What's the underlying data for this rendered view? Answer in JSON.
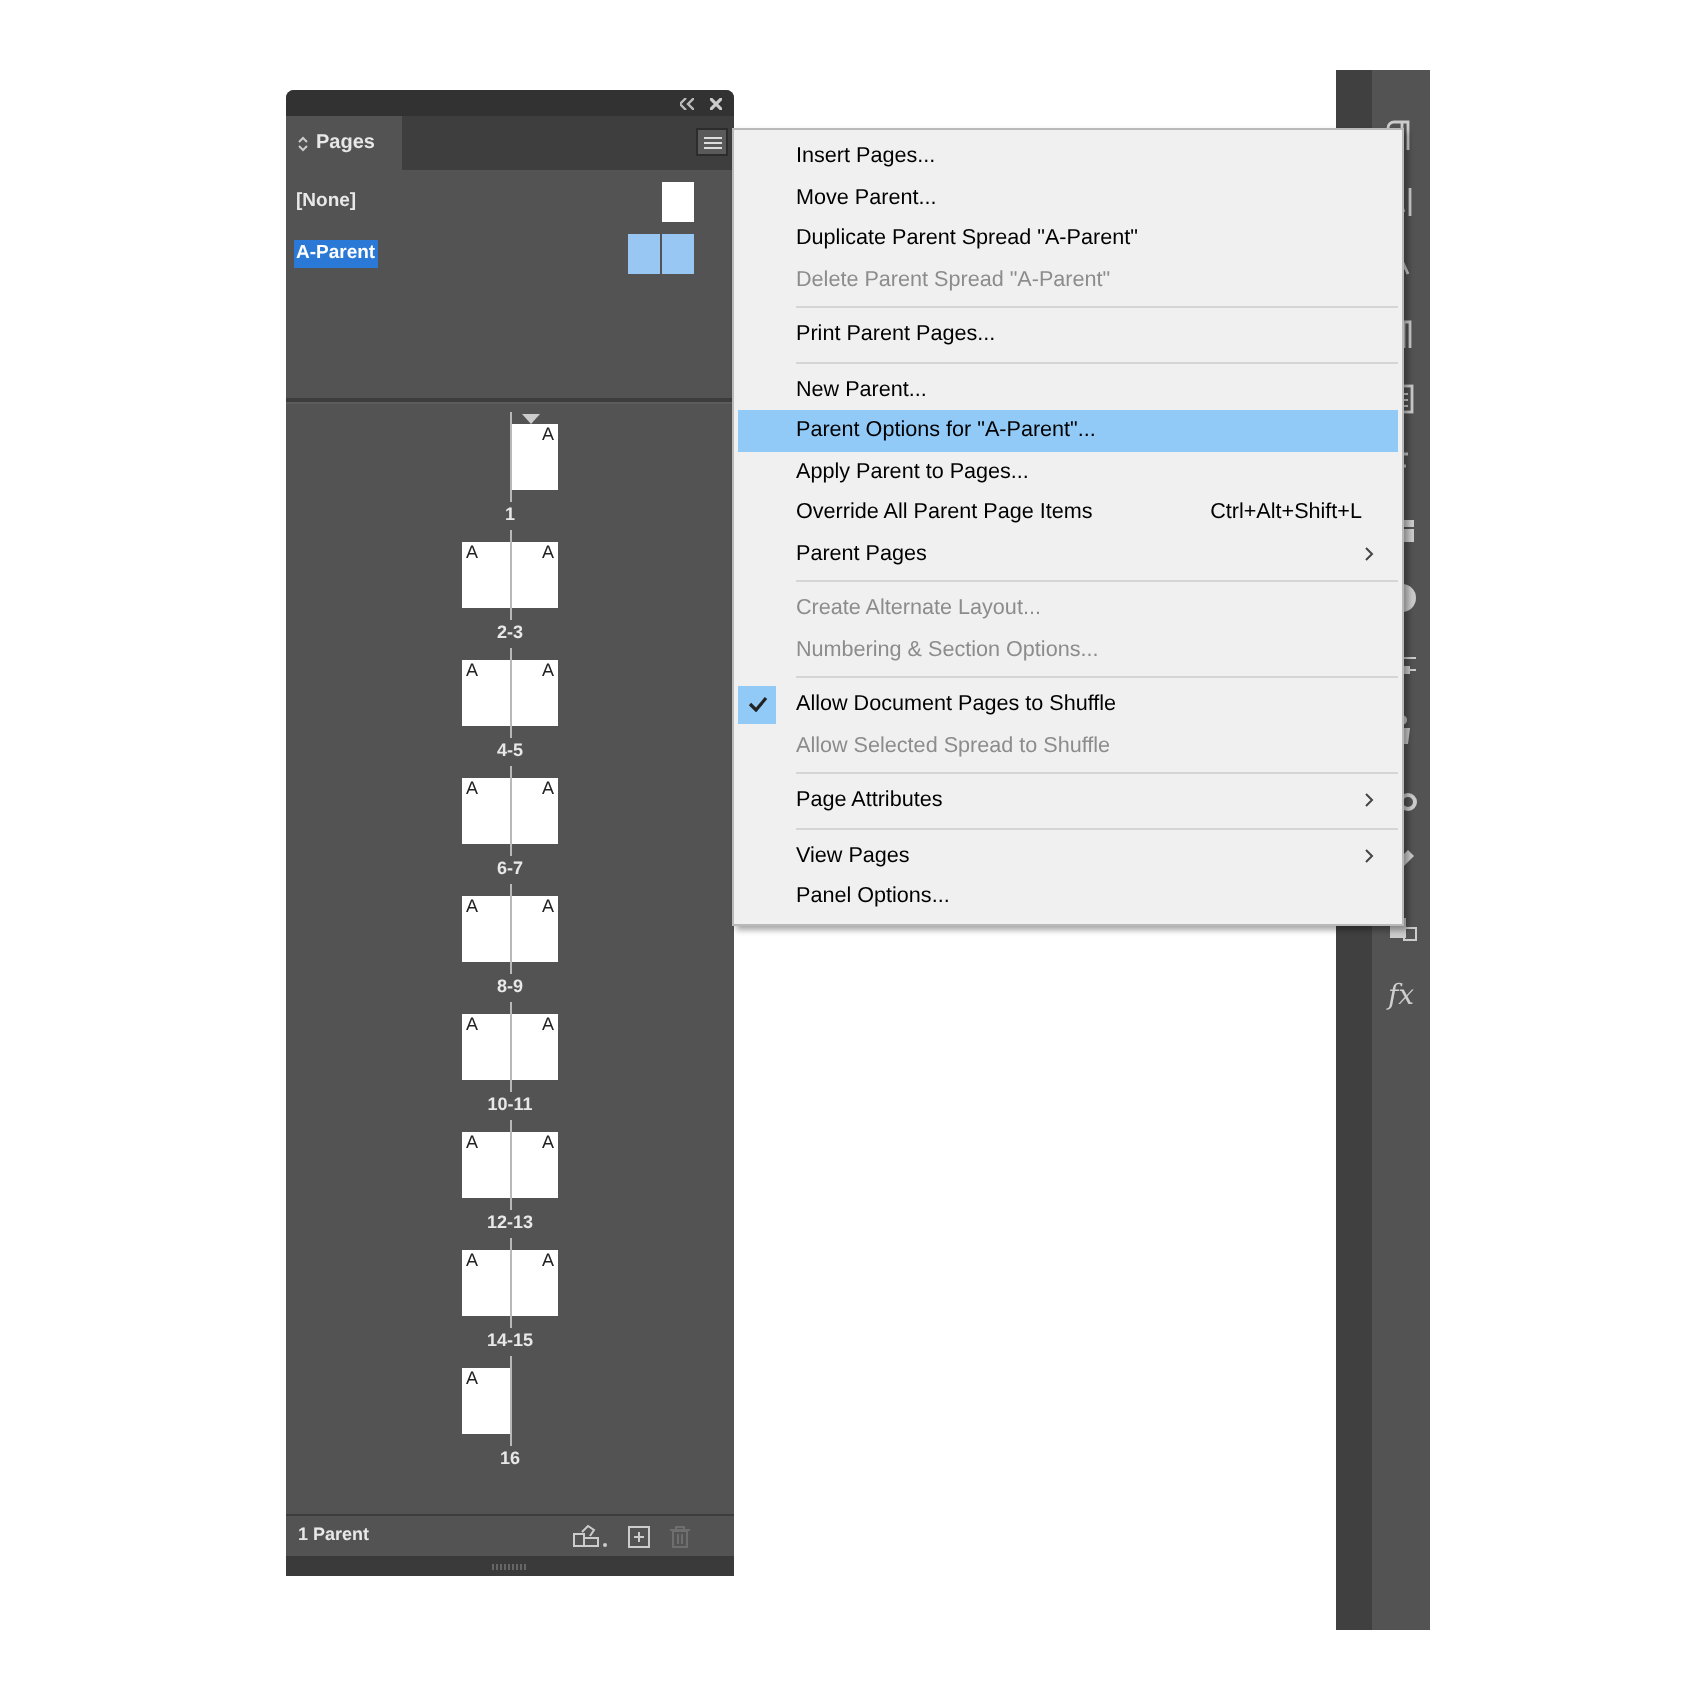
{
  "panel": {
    "tab": {
      "label": "Pages",
      "selected": true
    },
    "parents": [
      {
        "label": "[None]",
        "selected": false,
        "kind": "single"
      },
      {
        "label": "A-Parent",
        "selected": true,
        "kind": "facing"
      }
    ],
    "spreads": [
      {
        "label": "1",
        "current": true,
        "pages": [
          {
            "kind": "right",
            "prefix": "A"
          }
        ]
      },
      {
        "label": "2-3",
        "current": false,
        "pages": [
          {
            "kind": "left",
            "prefix": "A"
          },
          {
            "kind": "right",
            "prefix": "A"
          }
        ]
      },
      {
        "label": "4-5",
        "current": false,
        "pages": [
          {
            "kind": "left",
            "prefix": "A"
          },
          {
            "kind": "right",
            "prefix": "A"
          }
        ]
      },
      {
        "label": "6-7",
        "current": false,
        "pages": [
          {
            "kind": "left",
            "prefix": "A"
          },
          {
            "kind": "right",
            "prefix": "A"
          }
        ]
      },
      {
        "label": "8-9",
        "current": false,
        "pages": [
          {
            "kind": "left",
            "prefix": "A"
          },
          {
            "kind": "right",
            "prefix": "A"
          }
        ]
      },
      {
        "label": "10-11",
        "current": false,
        "pages": [
          {
            "kind": "left",
            "prefix": "A"
          },
          {
            "kind": "right",
            "prefix": "A"
          }
        ]
      },
      {
        "label": "12-13",
        "current": false,
        "pages": [
          {
            "kind": "left",
            "prefix": "A"
          },
          {
            "kind": "right",
            "prefix": "A"
          }
        ]
      },
      {
        "label": "14-15",
        "current": false,
        "pages": [
          {
            "kind": "left",
            "prefix": "A"
          },
          {
            "kind": "right",
            "prefix": "A"
          }
        ]
      },
      {
        "label": "16",
        "current": false,
        "pages": [
          {
            "kind": "left",
            "prefix": "A"
          }
        ]
      }
    ],
    "status": "1 Parent",
    "delete_disabled": true
  },
  "menu": {
    "items": [
      {
        "kind": "item",
        "label": "Insert Pages...",
        "disabled": false,
        "selected": false,
        "checked": false,
        "submenu": false
      },
      {
        "kind": "item",
        "label": "Move Parent...",
        "disabled": false,
        "selected": false,
        "checked": false,
        "submenu": false
      },
      {
        "kind": "item",
        "label": "Duplicate Parent Spread \"A-Parent\"",
        "disabled": false,
        "selected": false,
        "checked": false,
        "submenu": false
      },
      {
        "kind": "item",
        "label": "Delete Parent Spread \"A-Parent\"",
        "disabled": true,
        "selected": false,
        "checked": false,
        "submenu": false
      },
      {
        "kind": "separator"
      },
      {
        "kind": "item",
        "label": "Print Parent Pages...",
        "disabled": false,
        "selected": false,
        "checked": false,
        "submenu": false
      },
      {
        "kind": "separator"
      },
      {
        "kind": "item",
        "label": "New Parent...",
        "disabled": false,
        "selected": false,
        "checked": false,
        "submenu": false
      },
      {
        "kind": "item",
        "label": "Parent Options for \"A-Parent\"...",
        "disabled": false,
        "selected": true,
        "checked": false,
        "submenu": false
      },
      {
        "kind": "item",
        "label": "Apply Parent to Pages...",
        "disabled": false,
        "selected": false,
        "checked": false,
        "submenu": false
      },
      {
        "kind": "item",
        "label": "Override All Parent Page Items",
        "shortcut": "Ctrl+Alt+Shift+L",
        "disabled": false,
        "selected": false,
        "checked": false,
        "submenu": false
      },
      {
        "kind": "item",
        "label": "Parent Pages",
        "disabled": false,
        "selected": false,
        "checked": false,
        "submenu": true
      },
      {
        "kind": "separator"
      },
      {
        "kind": "item",
        "label": "Create Alternate Layout...",
        "disabled": true,
        "selected": false,
        "checked": false,
        "submenu": false
      },
      {
        "kind": "item",
        "label": "Numbering & Section Options...",
        "disabled": true,
        "selected": false,
        "checked": false,
        "submenu": false
      },
      {
        "kind": "separator"
      },
      {
        "kind": "item",
        "label": "Allow Document Pages to Shuffle",
        "disabled": false,
        "selected": false,
        "checked": true,
        "submenu": false
      },
      {
        "kind": "item",
        "label": "Allow Selected Spread to Shuffle",
        "disabled": true,
        "selected": false,
        "checked": false,
        "submenu": false
      },
      {
        "kind": "separator"
      },
      {
        "kind": "item",
        "label": "Page Attributes",
        "disabled": false,
        "selected": false,
        "checked": false,
        "submenu": true
      },
      {
        "kind": "separator"
      },
      {
        "kind": "item",
        "label": "View Pages",
        "disabled": false,
        "selected": false,
        "checked": false,
        "submenu": true
      },
      {
        "kind": "item",
        "label": "Panel Options...",
        "disabled": false,
        "selected": false,
        "checked": false,
        "submenu": false
      }
    ]
  },
  "toolbar": {
    "last_label": "fx"
  }
}
